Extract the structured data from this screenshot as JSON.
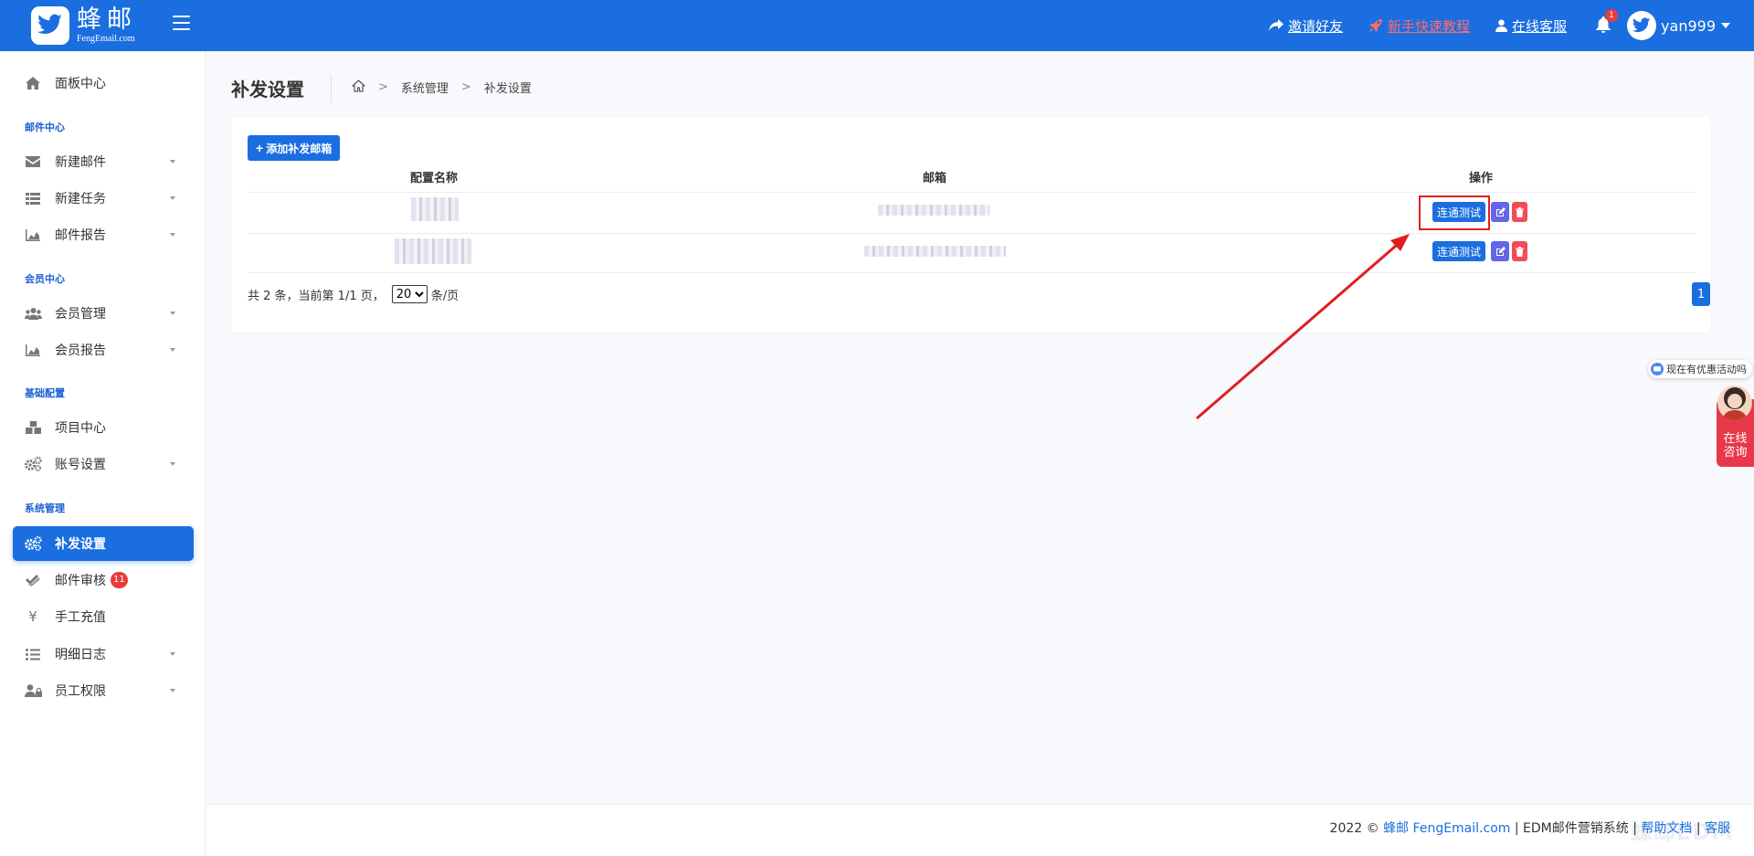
{
  "header": {
    "logo_title": "蜂邮",
    "logo_subtitle": "FengEmail.com",
    "links": {
      "invite": "邀请好友",
      "tutorial": "新手快速教程",
      "service": "在线客服"
    },
    "notification_count": "1",
    "username": "yan999"
  },
  "sidebar": {
    "dashboard": "面板中心",
    "section_mail": "邮件中心",
    "new_mail": "新建邮件",
    "new_task": "新建任务",
    "mail_report": "邮件报告",
    "section_member": "会员中心",
    "member_manage": "会员管理",
    "member_report": "会员报告",
    "section_basic": "基础配置",
    "project_center": "项目中心",
    "account_settings": "账号设置",
    "section_system": "系统管理",
    "resend_settings": "补发设置",
    "mail_review": "邮件审核",
    "mail_review_badge": "11",
    "manual_recharge": "手工充值",
    "detail_log": "明细日志",
    "staff_permission": "员工权限"
  },
  "page": {
    "title": "补发设置",
    "breadcrumb": [
      "系统管理",
      "补发设置"
    ]
  },
  "table": {
    "add_button": "添加补发邮箱",
    "columns": [
      "配置名称",
      "邮箱",
      "操作"
    ],
    "rows": [
      {
        "test_label": "连通测试"
      },
      {
        "test_label": "连通测试"
      }
    ]
  },
  "pagination": {
    "summary": "共 2 条，当前第 1/1 页，",
    "page_size": "20",
    "per_page_suffix": "条/页",
    "current_page": "1"
  },
  "float_widget": {
    "tip": "现在有优惠活动吗",
    "label_line1": "在线",
    "label_line2": "咨询"
  },
  "footer": {
    "year": "2022 ©",
    "brand": "蜂邮 FengEmail.com",
    "sep1": "|",
    "product": "EDM邮件营销系统",
    "sep2": "|",
    "help": "帮助文档",
    "sep3": "|",
    "service": "客服",
    "watermark": "蜂邮EDM"
  },
  "colors": {
    "primary": "#1a6ee0",
    "danger": "#f04c57",
    "edit": "#6366e8",
    "annotation": "#e01e1e"
  }
}
